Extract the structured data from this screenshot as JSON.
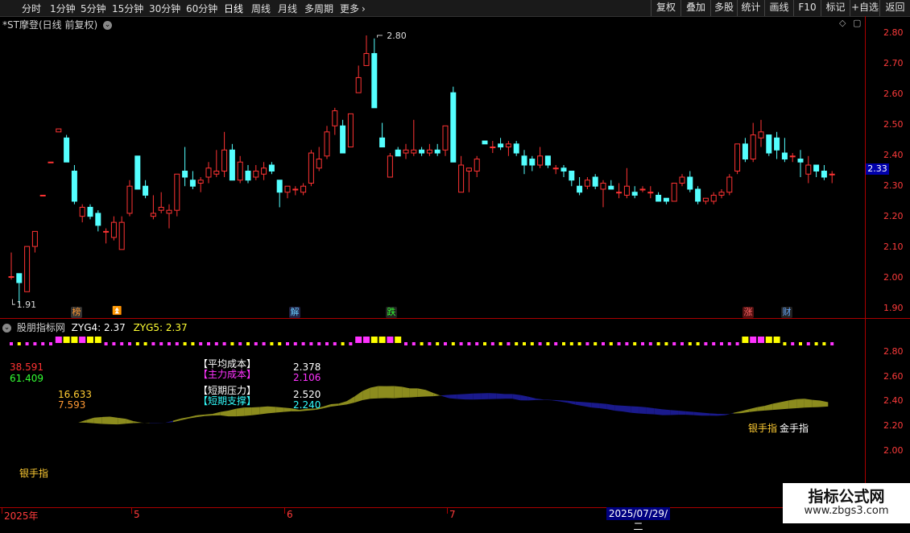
{
  "toolbar": {
    "periods": [
      "分时",
      "1分钟",
      "5分钟",
      "15分钟",
      "30分钟",
      "60分钟",
      "日线",
      "周线",
      "月线",
      "多周期"
    ],
    "more": "更多",
    "right_buttons": [
      "复权",
      "叠加",
      "多股",
      "统计",
      "画线",
      "F10",
      "标记",
      "+自选",
      "返回"
    ]
  },
  "chart_title": "*ST摩登(日线 前复权)",
  "price_axis": [
    "2.80",
    "2.70",
    "2.60",
    "2.50",
    "2.40",
    "2.30",
    "2.20",
    "2.10",
    "2.00",
    "1.90"
  ],
  "current_price": "2.33",
  "high_marker": "2.80",
  "low_marker": "1.91",
  "signals": [
    "榜",
    "解",
    "跌",
    "涨",
    "财"
  ],
  "indicator": {
    "name": "股朋指标网",
    "zyg4": "ZYG4: 2.37",
    "zyg5": "ZYG5: 2.37",
    "axis": [
      "2.80",
      "2.60",
      "2.40",
      "2.20",
      "2.00"
    ],
    "left_values": [
      "38.591",
      "61.409"
    ],
    "mid_values": [
      "16.633",
      "7.593"
    ],
    "avg_cost_label": "【平均成本】",
    "main_cost_label": "【主力成本】",
    "short_pressure_label": "【短期压力】",
    "short_support_label": "【短期支撑】",
    "avg_cost": "2.378",
    "main_cost": "2.106",
    "short_pressure": "2.520",
    "short_support": "2.240",
    "silver_hand_1": "银手指",
    "silver_hand_2": "银手指",
    "gold_hand": "金手指"
  },
  "date_axis": {
    "year": "2025年",
    "months": [
      "5",
      "6",
      "7"
    ],
    "cursor_date": "2025/07/29/二"
  },
  "watermark": {
    "title": "指标公式网",
    "url": "www.zbgs3.com"
  },
  "colors": {
    "up": "#ff3333",
    "down": "#54ffff",
    "axis": "#aa0000",
    "magenta": "#ff33ff",
    "yellow": "#ffff00",
    "olive": "#8c8c1e",
    "navy": "#1a1a8c"
  },
  "chart_data": {
    "type": "candlestick",
    "ylim": [
      1.88,
      2.83
    ],
    "candles": [
      {
        "o": 2.0,
        "h": 2.08,
        "l": 1.99,
        "c": 2.0
      },
      {
        "o": 2.01,
        "h": 2.01,
        "l": 1.91,
        "c": 1.98
      },
      {
        "o": 1.95,
        "h": 2.1,
        "l": 1.95,
        "c": 2.1
      },
      {
        "o": 2.1,
        "h": 2.15,
        "l": 2.08,
        "c": 2.15
      },
      {
        "o": 2.27,
        "h": 2.27,
        "l": 2.27,
        "c": 2.27
      },
      {
        "o": 2.38,
        "h": 2.38,
        "l": 2.38,
        "c": 2.38
      },
      {
        "o": 2.48,
        "h": 2.49,
        "l": 2.48,
        "c": 2.49
      },
      {
        "o": 2.46,
        "h": 2.47,
        "l": 2.38,
        "c": 2.38
      },
      {
        "o": 2.35,
        "h": 2.37,
        "l": 2.24,
        "c": 2.25
      },
      {
        "o": 2.2,
        "h": 2.24,
        "l": 2.18,
        "c": 2.23
      },
      {
        "o": 2.23,
        "h": 2.24,
        "l": 2.19,
        "c": 2.2
      },
      {
        "o": 2.21,
        "h": 2.22,
        "l": 2.15,
        "c": 2.17
      },
      {
        "o": 2.15,
        "h": 2.16,
        "l": 2.11,
        "c": 2.15
      },
      {
        "o": 2.13,
        "h": 2.2,
        "l": 2.12,
        "c": 2.18
      },
      {
        "o": 2.09,
        "h": 2.2,
        "l": 2.09,
        "c": 2.18
      },
      {
        "o": 2.21,
        "h": 2.32,
        "l": 2.2,
        "c": 2.3
      },
      {
        "o": 2.4,
        "h": 2.4,
        "l": 2.29,
        "c": 2.29
      },
      {
        "o": 2.3,
        "h": 2.32,
        "l": 2.26,
        "c": 2.27
      },
      {
        "o": 2.2,
        "h": 2.27,
        "l": 2.19,
        "c": 2.21
      },
      {
        "o": 2.22,
        "h": 2.28,
        "l": 2.21,
        "c": 2.23
      },
      {
        "o": 2.21,
        "h": 2.24,
        "l": 2.16,
        "c": 2.22
      },
      {
        "o": 2.22,
        "h": 2.34,
        "l": 2.2,
        "c": 2.34
      },
      {
        "o": 2.35,
        "h": 2.43,
        "l": 2.3,
        "c": 2.33
      },
      {
        "o": 2.32,
        "h": 2.35,
        "l": 2.29,
        "c": 2.3
      },
      {
        "o": 2.31,
        "h": 2.33,
        "l": 2.28,
        "c": 2.32
      },
      {
        "o": 2.33,
        "h": 2.38,
        "l": 2.31,
        "c": 2.36
      },
      {
        "o": 2.34,
        "h": 2.42,
        "l": 2.33,
        "c": 2.35
      },
      {
        "o": 2.35,
        "h": 2.48,
        "l": 2.33,
        "c": 2.42
      },
      {
        "o": 2.42,
        "h": 2.44,
        "l": 2.32,
        "c": 2.32
      },
      {
        "o": 2.32,
        "h": 2.4,
        "l": 2.31,
        "c": 2.38
      },
      {
        "o": 2.35,
        "h": 2.37,
        "l": 2.31,
        "c": 2.32
      },
      {
        "o": 2.33,
        "h": 2.37,
        "l": 2.32,
        "c": 2.35
      },
      {
        "o": 2.34,
        "h": 2.38,
        "l": 2.32,
        "c": 2.36
      },
      {
        "o": 2.37,
        "h": 2.38,
        "l": 2.34,
        "c": 2.35
      },
      {
        "o": 2.32,
        "h": 2.32,
        "l": 2.23,
        "c": 2.28
      },
      {
        "o": 2.28,
        "h": 2.3,
        "l": 2.26,
        "c": 2.3
      },
      {
        "o": 2.29,
        "h": 2.3,
        "l": 2.27,
        "c": 2.29
      },
      {
        "o": 2.28,
        "h": 2.31,
        "l": 2.27,
        "c": 2.3
      },
      {
        "o": 2.31,
        "h": 2.42,
        "l": 2.3,
        "c": 2.41
      },
      {
        "o": 2.36,
        "h": 2.43,
        "l": 2.35,
        "c": 2.39
      },
      {
        "o": 2.4,
        "h": 2.5,
        "l": 2.39,
        "c": 2.48
      },
      {
        "o": 2.5,
        "h": 2.56,
        "l": 2.47,
        "c": 2.55
      },
      {
        "o": 2.5,
        "h": 2.52,
        "l": 2.41,
        "c": 2.41
      },
      {
        "o": 2.43,
        "h": 2.54,
        "l": 2.43,
        "c": 2.54
      },
      {
        "o": 2.61,
        "h": 2.7,
        "l": 2.61,
        "c": 2.66
      },
      {
        "o": 2.7,
        "h": 2.8,
        "l": 2.7,
        "c": 2.74
      },
      {
        "o": 2.74,
        "h": 2.79,
        "l": 2.56,
        "c": 2.56
      },
      {
        "o": 2.46,
        "h": 2.51,
        "l": 2.44,
        "c": 2.43
      },
      {
        "o": 2.33,
        "h": 2.41,
        "l": 2.33,
        "c": 2.4
      },
      {
        "o": 2.42,
        "h": 2.43,
        "l": 2.4,
        "c": 2.4
      },
      {
        "o": 2.41,
        "h": 2.44,
        "l": 2.39,
        "c": 2.42
      },
      {
        "o": 2.41,
        "h": 2.52,
        "l": 2.4,
        "c": 2.42
      },
      {
        "o": 2.42,
        "h": 2.43,
        "l": 2.4,
        "c": 2.41
      },
      {
        "o": 2.41,
        "h": 2.44,
        "l": 2.4,
        "c": 2.42
      },
      {
        "o": 2.42,
        "h": 2.44,
        "l": 2.4,
        "c": 2.41
      },
      {
        "o": 2.42,
        "h": 2.5,
        "l": 2.4,
        "c": 2.5
      },
      {
        "o": 2.61,
        "h": 2.63,
        "l": 2.38,
        "c": 2.38
      },
      {
        "o": 2.28,
        "h": 2.4,
        "l": 2.28,
        "c": 2.37
      },
      {
        "o": 2.35,
        "h": 2.36,
        "l": 2.28,
        "c": 2.36
      },
      {
        "o": 2.35,
        "h": 2.4,
        "l": 2.33,
        "c": 2.39
      },
      {
        "o": 2.45,
        "h": 2.45,
        "l": 2.44,
        "c": 2.44
      },
      {
        "o": 2.43,
        "h": 2.45,
        "l": 2.41,
        "c": 2.43
      },
      {
        "o": 2.44,
        "h": 2.46,
        "l": 2.42,
        "c": 2.43
      },
      {
        "o": 2.43,
        "h": 2.45,
        "l": 2.4,
        "c": 2.44
      },
      {
        "o": 2.44,
        "h": 2.45,
        "l": 2.4,
        "c": 2.41
      },
      {
        "o": 2.4,
        "h": 2.42,
        "l": 2.34,
        "c": 2.37
      },
      {
        "o": 2.39,
        "h": 2.4,
        "l": 2.35,
        "c": 2.37
      },
      {
        "o": 2.37,
        "h": 2.43,
        "l": 2.36,
        "c": 2.4
      },
      {
        "o": 2.4,
        "h": 2.4,
        "l": 2.36,
        "c": 2.37
      },
      {
        "o": 2.36,
        "h": 2.37,
        "l": 2.34,
        "c": 2.36
      },
      {
        "o": 2.36,
        "h": 2.37,
        "l": 2.33,
        "c": 2.35
      },
      {
        "o": 2.35,
        "h": 2.35,
        "l": 2.3,
        "c": 2.32
      },
      {
        "o": 2.3,
        "h": 2.33,
        "l": 2.27,
        "c": 2.28
      },
      {
        "o": 2.3,
        "h": 2.33,
        "l": 2.29,
        "c": 2.32
      },
      {
        "o": 2.33,
        "h": 2.34,
        "l": 2.29,
        "c": 2.3
      },
      {
        "o": 2.29,
        "h": 2.32,
        "l": 2.23,
        "c": 2.31
      },
      {
        "o": 2.3,
        "h": 2.32,
        "l": 2.29,
        "c": 2.29
      },
      {
        "o": 2.28,
        "h": 2.31,
        "l": 2.26,
        "c": 2.28
      },
      {
        "o": 2.27,
        "h": 2.36,
        "l": 2.26,
        "c": 2.3
      },
      {
        "o": 2.28,
        "h": 2.3,
        "l": 2.26,
        "c": 2.27
      },
      {
        "o": 2.29,
        "h": 2.3,
        "l": 2.28,
        "c": 2.29
      },
      {
        "o": 2.28,
        "h": 2.3,
        "l": 2.26,
        "c": 2.28
      },
      {
        "o": 2.27,
        "h": 2.28,
        "l": 2.25,
        "c": 2.25
      },
      {
        "o": 2.26,
        "h": 2.26,
        "l": 2.24,
        "c": 2.25
      },
      {
        "o": 2.25,
        "h": 2.31,
        "l": 2.25,
        "c": 2.31
      },
      {
        "o": 2.31,
        "h": 2.34,
        "l": 2.3,
        "c": 2.33
      },
      {
        "o": 2.33,
        "h": 2.35,
        "l": 2.28,
        "c": 2.29
      },
      {
        "o": 2.29,
        "h": 2.3,
        "l": 2.24,
        "c": 2.25
      },
      {
        "o": 2.25,
        "h": 2.26,
        "l": 2.24,
        "c": 2.26
      },
      {
        "o": 2.25,
        "h": 2.28,
        "l": 2.24,
        "c": 2.27
      },
      {
        "o": 2.27,
        "h": 2.29,
        "l": 2.26,
        "c": 2.28
      },
      {
        "o": 2.28,
        "h": 2.34,
        "l": 2.27,
        "c": 2.33
      },
      {
        "o": 2.35,
        "h": 2.44,
        "l": 2.34,
        "c": 2.44
      },
      {
        "o": 2.44,
        "h": 2.46,
        "l": 2.38,
        "c": 2.39
      },
      {
        "o": 2.39,
        "h": 2.51,
        "l": 2.38,
        "c": 2.47
      },
      {
        "o": 2.46,
        "h": 2.52,
        "l": 2.43,
        "c": 2.48
      },
      {
        "o": 2.47,
        "h": 2.47,
        "l": 2.4,
        "c": 2.41
      },
      {
        "o": 2.46,
        "h": 2.48,
        "l": 2.39,
        "c": 2.42
      },
      {
        "o": 2.41,
        "h": 2.46,
        "l": 2.38,
        "c": 2.39
      },
      {
        "o": 2.4,
        "h": 2.41,
        "l": 2.38,
        "c": 2.4
      },
      {
        "o": 2.39,
        "h": 2.42,
        "l": 2.33,
        "c": 2.38
      },
      {
        "o": 2.34,
        "h": 2.4,
        "l": 2.31,
        "c": 2.37
      },
      {
        "o": 2.37,
        "h": 2.37,
        "l": 2.33,
        "c": 2.35
      },
      {
        "o": 2.35,
        "h": 2.37,
        "l": 2.32,
        "c": 2.33
      },
      {
        "o": 2.34,
        "h": 2.35,
        "l": 2.31,
        "c": 2.34
      }
    ]
  }
}
